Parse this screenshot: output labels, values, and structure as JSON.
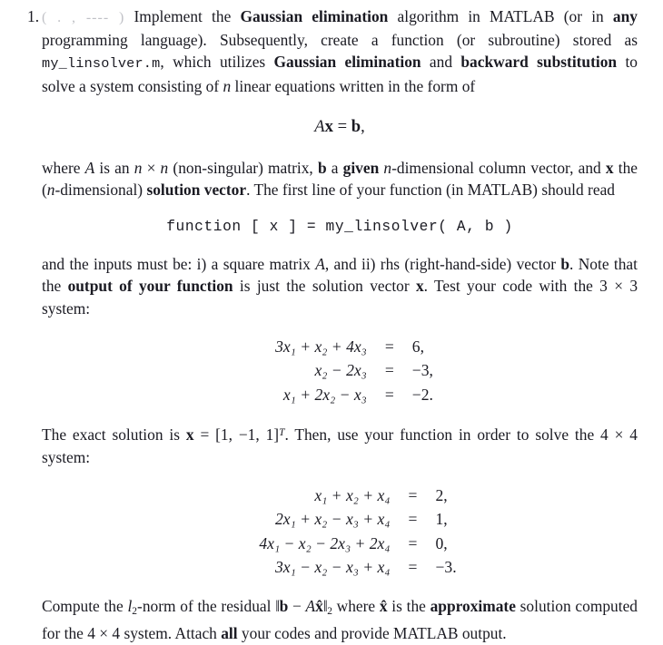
{
  "document": {
    "type": "homework-problem",
    "background_color": "#ffffff",
    "text_color": "#1a1a22"
  },
  "problem": {
    "number": "1.",
    "points_marker": "( . , ---- )",
    "points_marker_note": "faded / illegible parenthetical",
    "paragraph_1": {
      "seg_1": "Implement the ",
      "bold_1": "Gaussian elimination",
      "seg_2": " algorithm in MATLAB (or in ",
      "bold_2": "any",
      "seg_3": " programming language). Subsequently, create a function (or subroutine) stored as ",
      "mono_1": "my_linsolver.m",
      "seg_4": ", which utilizes ",
      "bold_3": "Gaussian elimination",
      "seg_5": " and ",
      "bold_4": "backward substitution",
      "seg_6": " to solve a system consisting of ",
      "var_n": "n",
      "seg_7": " linear equations written in the form of"
    },
    "display_equation_1": {
      "matrix": "A",
      "unknown": "x",
      "relation": "=",
      "rhs": "b",
      "trailing": ",",
      "plain": "Ax = b,"
    },
    "paragraph_2": {
      "seg_1": "where ",
      "var_A": "A",
      "seg_2": " is an ",
      "var_n1": "n",
      "times": " × ",
      "var_n2": "n",
      "seg_3": " (non-singular) matrix, ",
      "bold_b": "b",
      "seg_4": " a ",
      "bold_given": "given",
      "seg_5": " ",
      "var_n3": "n",
      "seg_6": "-dimensional column vector, and ",
      "bold_x": "x",
      "seg_7": " the (",
      "var_n4": "n",
      "seg_8": "-dimensional) ",
      "bold_sol": "solution vector",
      "seg_9": ". The first line of your function (in MATLAB) should read"
    },
    "code_line": "function [ x ] = my_linsolver( A, b )",
    "paragraph_3": {
      "seg_1": "and the inputs must be: i) a square matrix ",
      "var_A": "A",
      "seg_2": ", and ii) rhs (right-hand-side) vector ",
      "bold_b": "b",
      "seg_3": ". Note that the ",
      "bold_out": "output of your function",
      "seg_4": " is just the solution vector ",
      "bold_x": "x",
      "seg_5": ". Test your code with the 3 × 3 system:"
    },
    "system_3x3": {
      "size": "3 × 3",
      "equations": [
        {
          "lhs": "3x₁ + x₂ + 4x₃",
          "rel": "=",
          "rhs": "6,"
        },
        {
          "lhs": "x₂ − 2x₃",
          "rel": "=",
          "rhs": "−3,"
        },
        {
          "lhs": "x₁ + 2x₂ − x₃",
          "rel": "=",
          "rhs": "−2."
        }
      ],
      "coefficients": [
        [
          3,
          1,
          4
        ],
        [
          0,
          1,
          -2
        ],
        [
          1,
          2,
          -1
        ]
      ],
      "rhs_vector": [
        6,
        -3,
        -2
      ]
    },
    "paragraph_4": {
      "seg_1": "The exact solution is ",
      "bold_x": "x",
      "seg_2": " = [1, −1, 1]",
      "supT": "T",
      "seg_3": ". Then, use your function in order to solve the 4 × 4 system:",
      "exact_solution": [
        1,
        -1,
        1
      ]
    },
    "system_4x4": {
      "size": "4 × 4",
      "equations": [
        {
          "lhs": "x₁ + x₂ + x₄",
          "rel": "=",
          "rhs": "2,"
        },
        {
          "lhs": "2x₁ + x₂ − x₃ + x₄",
          "rel": "=",
          "rhs": "1,"
        },
        {
          "lhs": "4x₁ − x₂ − 2x₃ + 2x₄",
          "rel": "=",
          "rhs": "0,"
        },
        {
          "lhs": "3x₁ − x₂ − x₃ + x₄",
          "rel": "=",
          "rhs": "−3."
        }
      ],
      "coefficients": [
        [
          1,
          1,
          0,
          1
        ],
        [
          2,
          1,
          -1,
          1
        ],
        [
          4,
          -1,
          -2,
          2
        ],
        [
          3,
          -1,
          -1,
          1
        ]
      ],
      "rhs_vector": [
        2,
        1,
        0,
        -3
      ]
    },
    "paragraph_5": {
      "seg_1": "Compute the ",
      "var_l": "l",
      "sub2": "2",
      "seg_2": "-norm of the residual ",
      "norm_open": "‖",
      "bold_b": "b",
      "minus": " − ",
      "var_A": "A",
      "bold_xhat": "x̂",
      "norm_close": "‖",
      "sub2b": "2",
      "seg_3": " where ",
      "bold_xhat2": "x̂",
      "seg_4": " is the ",
      "bold_approx": "approximate",
      "seg_5": " solution computed for the 4 × 4 system. Attach ",
      "bold_all": "all",
      "seg_6": " your codes and provide MATLAB output."
    }
  }
}
